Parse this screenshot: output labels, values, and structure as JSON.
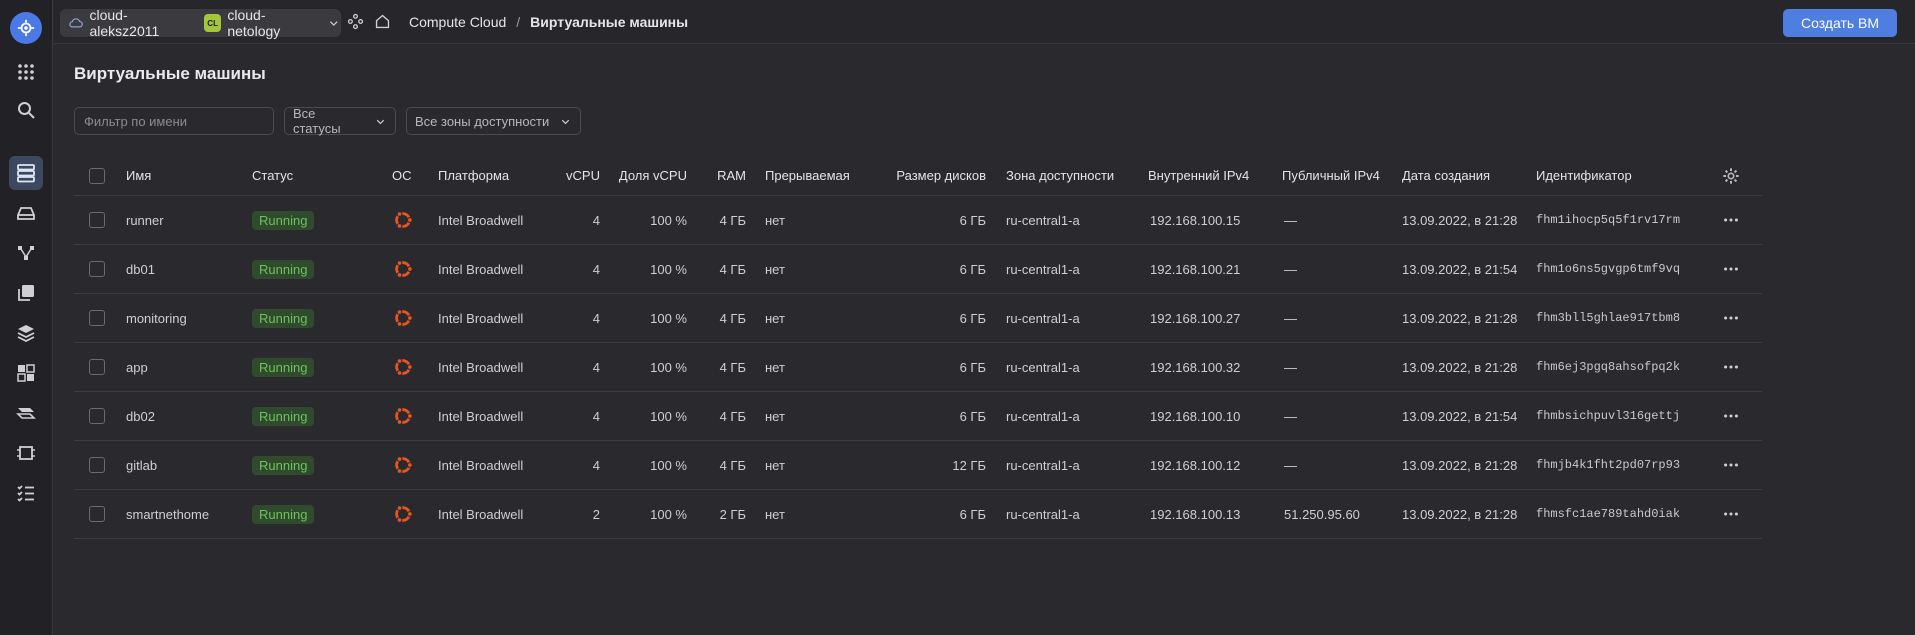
{
  "topbar": {
    "cloud_name": "cloud-aleksz2011",
    "folder_badge": "CL",
    "folder_name": "cloud-netology",
    "breadcrumb_service": "Compute Cloud",
    "breadcrumb_sep": "/",
    "breadcrumb_current": "Виртуальные машины",
    "create_button": "Создать ВМ"
  },
  "page": {
    "title": "Виртуальные машины"
  },
  "filters": {
    "name_placeholder": "Фильтр по имени",
    "status_select": "Все статусы",
    "zone_select": "Все зоны доступности"
  },
  "table": {
    "headers": {
      "name": "Имя",
      "status": "Статус",
      "os": "ОС",
      "platform": "Платформа",
      "vcpu": "vCPU",
      "vcpu_share": "Доля vCPU",
      "ram": "RAM",
      "preemptible": "Прерываемая",
      "disk_size": "Размер дисков",
      "zone": "Зона доступности",
      "internal_ip": "Внутренний IPv4",
      "public_ip": "Публичный IPv4",
      "created": "Дата создания",
      "id": "Идентификатор"
    },
    "rows": [
      {
        "name": "runner",
        "status": "Running",
        "platform": "Intel Broadwell",
        "vcpu": "4",
        "vcpu_share": "100 %",
        "ram": "4 ГБ",
        "preemptible": "нет",
        "disk_size": "6 ГБ",
        "zone": "ru-central1-a",
        "internal_ip": "192.168.100.15",
        "public_ip": "—",
        "created": "13.09.2022, в 21:28",
        "id": "fhm1ihocp5q5f1rv17rm"
      },
      {
        "name": "db01",
        "status": "Running",
        "platform": "Intel Broadwell",
        "vcpu": "4",
        "vcpu_share": "100 %",
        "ram": "4 ГБ",
        "preemptible": "нет",
        "disk_size": "6 ГБ",
        "zone": "ru-central1-a",
        "internal_ip": "192.168.100.21",
        "public_ip": "—",
        "created": "13.09.2022, в 21:54",
        "id": "fhm1o6ns5gvgp6tmf9vq"
      },
      {
        "name": "monitoring",
        "status": "Running",
        "platform": "Intel Broadwell",
        "vcpu": "4",
        "vcpu_share": "100 %",
        "ram": "4 ГБ",
        "preemptible": "нет",
        "disk_size": "6 ГБ",
        "zone": "ru-central1-a",
        "internal_ip": "192.168.100.27",
        "public_ip": "—",
        "created": "13.09.2022, в 21:28",
        "id": "fhm3bll5ghlae917tbm8"
      },
      {
        "name": "app",
        "status": "Running",
        "platform": "Intel Broadwell",
        "vcpu": "4",
        "vcpu_share": "100 %",
        "ram": "4 ГБ",
        "preemptible": "нет",
        "disk_size": "6 ГБ",
        "zone": "ru-central1-a",
        "internal_ip": "192.168.100.32",
        "public_ip": "—",
        "created": "13.09.2022, в 21:28",
        "id": "fhm6ej3pgq8ahsofpq2k"
      },
      {
        "name": "db02",
        "status": "Running",
        "platform": "Intel Broadwell",
        "vcpu": "4",
        "vcpu_share": "100 %",
        "ram": "4 ГБ",
        "preemptible": "нет",
        "disk_size": "6 ГБ",
        "zone": "ru-central1-a",
        "internal_ip": "192.168.100.10",
        "public_ip": "—",
        "created": "13.09.2022, в 21:54",
        "id": "fhmbsichpuvl316gettj"
      },
      {
        "name": "gitlab",
        "status": "Running",
        "platform": "Intel Broadwell",
        "vcpu": "4",
        "vcpu_share": "100 %",
        "ram": "4 ГБ",
        "preemptible": "нет",
        "disk_size": "12 ГБ",
        "zone": "ru-central1-a",
        "internal_ip": "192.168.100.12",
        "public_ip": "—",
        "created": "13.09.2022, в 21:28",
        "id": "fhmjb4k1fht2pd07rp93"
      },
      {
        "name": "smartnethome",
        "status": "Running",
        "platform": "Intel Broadwell",
        "vcpu": "2",
        "vcpu_share": "100 %",
        "ram": "2 ГБ",
        "preemptible": "нет",
        "disk_size": "6 ГБ",
        "zone": "ru-central1-a",
        "internal_ip": "192.168.100.13",
        "public_ip": "51.250.95.60",
        "created": "13.09.2022, в 21:28",
        "id": "fhmsfc1ae789tahd0iak"
      }
    ]
  },
  "icons": {
    "os": "ubuntu-icon",
    "row_menu": "more-horizontal-icon",
    "settings": "gear-icon"
  },
  "colors": {
    "accent": "#4e7ee0",
    "status_running": "#6ec15c",
    "ubuntu": "#e95420"
  }
}
